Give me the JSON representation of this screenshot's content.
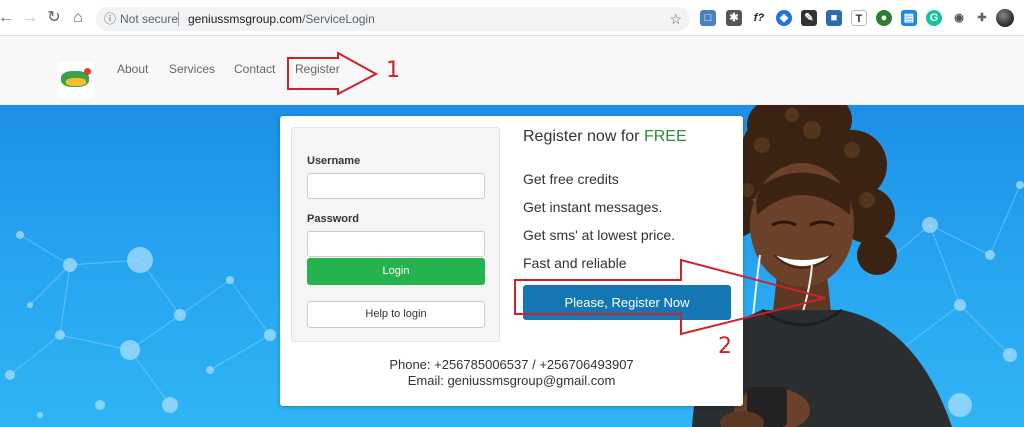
{
  "browser": {
    "security_label": "Not secure",
    "url_host": "geniussmsgroup.com",
    "url_path": "/ServiceLogin",
    "extension_icons": [
      "address-book-icon",
      "puzzle-icon",
      "formula-icon",
      "drop-icon",
      "pen-icon",
      "key-icon",
      "text-icon",
      "globe-icon",
      "tab-icon",
      "grammarly-icon",
      "camera-icon",
      "extensions-icon"
    ]
  },
  "site_nav": {
    "items": [
      "About",
      "Services",
      "Contact",
      "Register"
    ]
  },
  "annotations": {
    "step1": "1",
    "step2": "2",
    "color": "#d0202a"
  },
  "login": {
    "username_label": "Username",
    "password_label": "Password",
    "login_button": "Login",
    "help_button": "Help to login"
  },
  "register": {
    "title_prefix": "Register now for ",
    "title_free": "FREE",
    "features": [
      "Get free credits",
      "Get instant messages.",
      "Get sms' at lowest price.",
      "Fast and reliable"
    ],
    "button": "Please, Register Now"
  },
  "contact": {
    "phone": "Phone: +256785006537 / +256706493907",
    "email": "Email: geniussmsgroup@gmail.com"
  },
  "colors": {
    "login_green": "#26b24f",
    "register_blue": "#1477b4",
    "free_green": "#2e8b3a",
    "hero_blue": "#1d8fe6"
  }
}
